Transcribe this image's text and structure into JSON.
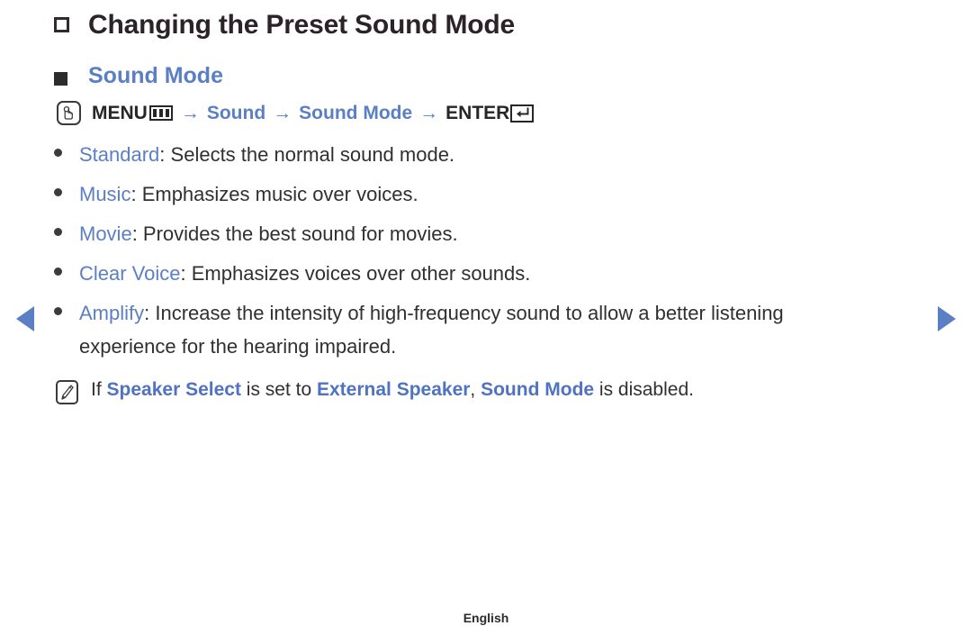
{
  "heading": {
    "title": "Changing the Preset Sound Mode",
    "bullet_icon": "hollow-square"
  },
  "section": {
    "title": "Sound Mode",
    "bullet_icon": "filled-square"
  },
  "menu_path": {
    "press_icon": "hand-press-icon",
    "menu_label": "MENU",
    "menu_icon": "menu-grid-icon",
    "arrow": "→",
    "step1": "Sound",
    "step2": "Sound Mode",
    "enter_label": "ENTER",
    "enter_icon": "enter-return-icon"
  },
  "modes": [
    {
      "term": "Standard",
      "separator": ": ",
      "description": "Selects the normal sound mode."
    },
    {
      "term": "Music",
      "separator": ": ",
      "description": "Emphasizes music over voices."
    },
    {
      "term": "Movie",
      "separator": ": ",
      "description": "Provides the best sound for movies."
    },
    {
      "term": "Clear Voice",
      "separator": ": ",
      "description": "Emphasizes voices over other sounds."
    },
    {
      "term": "Amplify",
      "separator": ": ",
      "description": "Increase the intensity of high-frequency sound to allow a better listening experience for the hearing impaired."
    }
  ],
  "note": {
    "icon": "note-pencil-icon",
    "prefix": "If ",
    "term1": "Speaker Select",
    "mid1": " is set to ",
    "term2": "External Speaker",
    "mid2": ", ",
    "term3": "Sound Mode",
    "suffix": " is disabled."
  },
  "nav": {
    "prev_icon": "triangle-left-icon",
    "next_icon": "triangle-right-icon"
  },
  "footer": {
    "language": "English"
  },
  "colors": {
    "accent_blue": "#5b7fc4",
    "note_blue": "#4f73c0",
    "text_dark": "#303030",
    "background": "#ffffff"
  }
}
